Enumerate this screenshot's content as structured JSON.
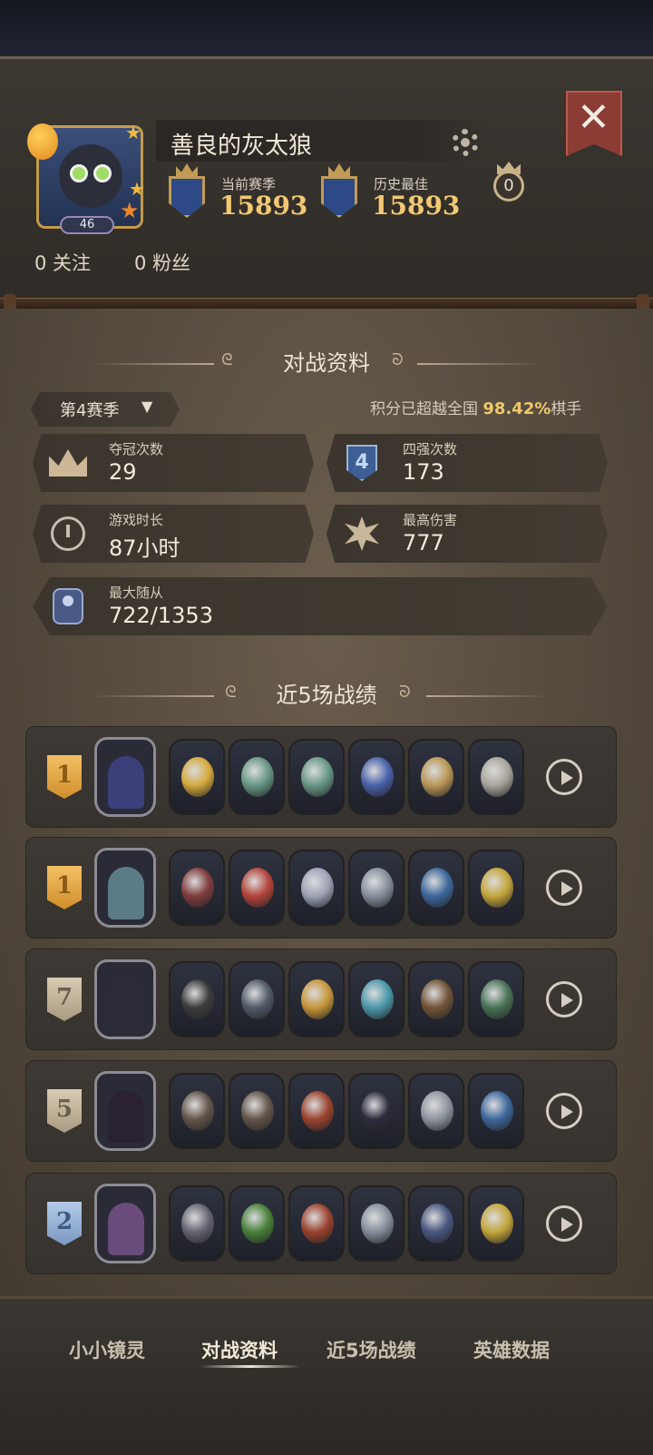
{
  "profile": {
    "name": "善良的灰太狼",
    "level": "46",
    "current_season_label": "当前赛季",
    "current_season_score": "15893",
    "best_label": "历史最佳",
    "best_score": "15893",
    "trophy_count": "0",
    "following": "0 关注",
    "followers": "0 粉丝"
  },
  "battle_info": {
    "title": "对战资料",
    "season": "第4赛季",
    "rank_note_prefix": "积分已超越全国",
    "rank_percent": "98.42%",
    "rank_note_suffix": "棋手",
    "stats": [
      {
        "label": "夺冠次数",
        "value": "29",
        "icon": "crown-icon"
      },
      {
        "label": "四强次数",
        "value": "173",
        "icon": "top4-icon"
      },
      {
        "label": "游戏时长",
        "value": "87小时",
        "icon": "clock-icon"
      },
      {
        "label": "最高伤害",
        "value": "777",
        "icon": "damage-icon"
      },
      {
        "label": "最大随从",
        "value": "722/1353",
        "icon": "minion-icon"
      }
    ]
  },
  "recent": {
    "title": "近5场战绩",
    "matches": [
      {
        "placement": "1",
        "badge": "gold"
      },
      {
        "placement": "1",
        "badge": "gold"
      },
      {
        "placement": "7",
        "badge": "tan"
      },
      {
        "placement": "5",
        "badge": "tan"
      },
      {
        "placement": "2",
        "badge": "blue"
      }
    ]
  },
  "tabs": [
    "小小镜灵",
    "对战资料",
    "近5场战绩",
    "英雄数据"
  ],
  "colors": {
    "accent": "#f2c873",
    "paper": "#5c5043",
    "active_tab": "#f1e8d7"
  }
}
